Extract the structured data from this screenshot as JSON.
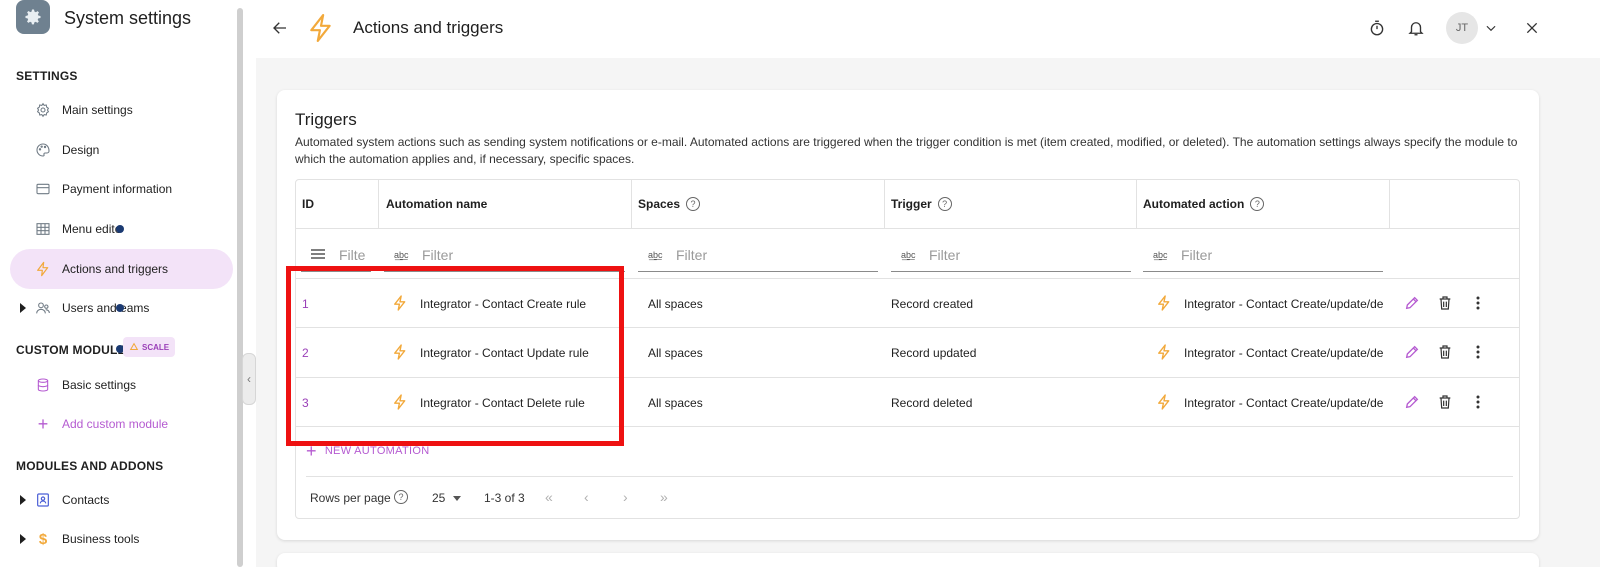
{
  "sidebar": {
    "app_title": "System settings",
    "section_settings": "SETTINGS",
    "items_settings": [
      {
        "label": "Main settings",
        "icon": "gear-icon"
      },
      {
        "label": "Design",
        "icon": "palette-icon"
      },
      {
        "label": "Payment information",
        "icon": "credit-card-icon"
      },
      {
        "label": "Menu edito",
        "icon": "grid-icon"
      },
      {
        "label": "Actions and triggers",
        "icon": "bolt-icon",
        "active": true
      },
      {
        "label": "Users and eams",
        "icon": "users-icon"
      }
    ],
    "section_custom": "CUSTOM MODULES",
    "scale_badge": "SCALE",
    "items_custom": [
      {
        "label": "Basic settings",
        "icon": "database-icon"
      },
      {
        "label": "Add custom module",
        "icon": "plus-icon"
      }
    ],
    "section_modules": "MODULES AND ADDONS",
    "items_modules": [
      {
        "label": "Contacts",
        "icon": "contact-card-icon"
      },
      {
        "label": "Business tools",
        "icon": "dollar-icon"
      }
    ]
  },
  "header": {
    "title": "Actions and triggers",
    "avatar_initials": "JT"
  },
  "card": {
    "title": "Triggers",
    "description": "Automated system actions such as sending system notifications or e-mail. Automated actions are triggered when the trigger condition is met (item created, modified, or deleted). The automation settings always specify the module to which the automation applies and, if necessary, specific spaces."
  },
  "table": {
    "columns": [
      "ID",
      "Automation name",
      "Spaces",
      "Trigger",
      "Automated action"
    ],
    "filter_placeholder": "Filter",
    "id_filter_placeholder": "Filte",
    "rows": [
      {
        "id": "1",
        "name": "Integrator - Contact Create rule",
        "spaces": "All spaces",
        "trigger": "Record created",
        "action": "Integrator - Contact Create/update/dele"
      },
      {
        "id": "2",
        "name": "Integrator - Contact Update rule",
        "spaces": "All spaces",
        "trigger": "Record updated",
        "action": "Integrator - Contact Create/update/dele"
      },
      {
        "id": "3",
        "name": "Integrator - Contact Delete rule",
        "spaces": "All spaces",
        "trigger": "Record deleted",
        "action": "Integrator - Contact Create/update/dele"
      }
    ],
    "new_automation": "NEW AUTOMATION"
  },
  "pagination": {
    "rows_per_page_label": "Rows per page",
    "rows_per_page": "25",
    "range": "1-3 of 3"
  },
  "colors": {
    "accent": "#b55bd1",
    "bolt": "#f2a93b",
    "highlight": "#ee1111",
    "active_bg": "#f3e3f8"
  }
}
